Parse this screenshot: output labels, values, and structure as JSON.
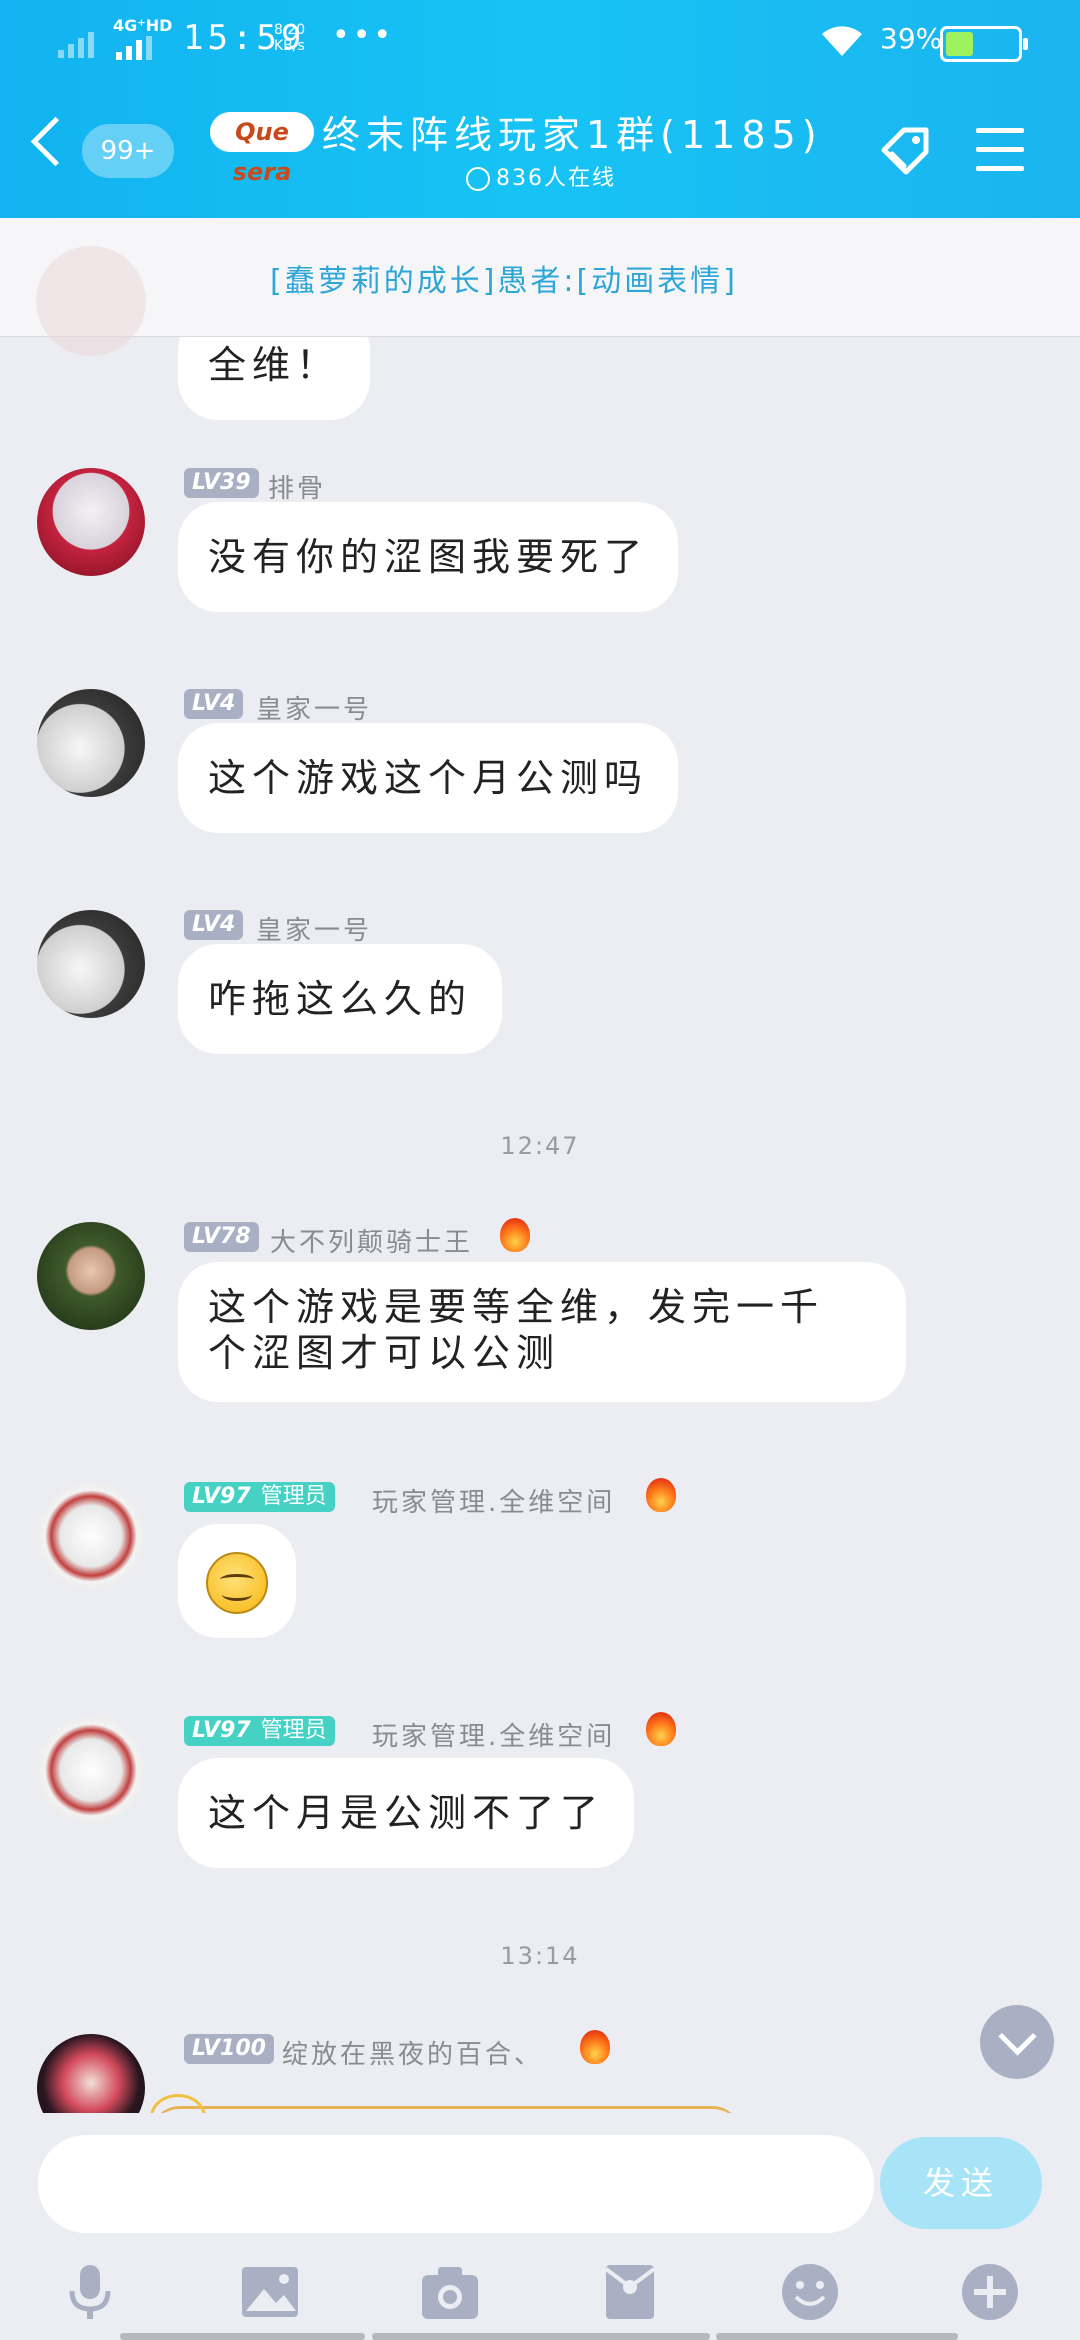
{
  "status_bar": {
    "network": "4G⁺HD",
    "time": "15:59",
    "speed_value": "8.20",
    "speed_unit": "KB/s",
    "more": "•••",
    "battery_pct": "39%",
    "battery_level": 0.39
  },
  "header": {
    "unread_badge": "99+",
    "logo_text": "Que sera",
    "group_title": "终末阵线玩家1群(1185)",
    "online_text": "836人在线"
  },
  "pinned": {
    "text": "[蠢萝莉的成长]愚者:[动画表情]"
  },
  "messages": [
    {
      "level": "LV39",
      "name": "排骨",
      "text": "没有你的涩图我要死了"
    },
    {
      "level": "LV4",
      "name": "皇家一号",
      "text": "这个游戏这个月公测吗"
    },
    {
      "level": "LV4",
      "name": "皇家一号",
      "text": "咋拖这么久的"
    },
    {
      "level": "LV78",
      "name": "大不列颠骑士王",
      "text_line1": "这个游戏是要等全维，发完一千",
      "text_line2": "个涩图才可以公测"
    },
    {
      "level": "LV97",
      "role": "管理员",
      "name": "玩家管理.全维空间",
      "emoji": "smiley"
    },
    {
      "level": "LV97",
      "role": "管理员",
      "name": "玩家管理.全维空间",
      "text": "这个月是公测不了了"
    },
    {
      "level": "LV100",
      "name": "绽放在黑夜的百合、"
    }
  ],
  "partial_top_text": "全维！",
  "timestamps": [
    "12:47",
    "13:14"
  ],
  "input": {
    "placeholder": "",
    "send_label": "发送"
  },
  "toolbar": {
    "icons": [
      "microphone-icon",
      "image-icon",
      "camera-icon",
      "red-packet-icon",
      "emoji-icon",
      "plus-icon"
    ]
  },
  "colors": {
    "header_blue": "#17c3f4",
    "admin_badge": "#45d1c4",
    "level_badge": "#a9b0c4",
    "send_button": "#a8e4f8"
  }
}
